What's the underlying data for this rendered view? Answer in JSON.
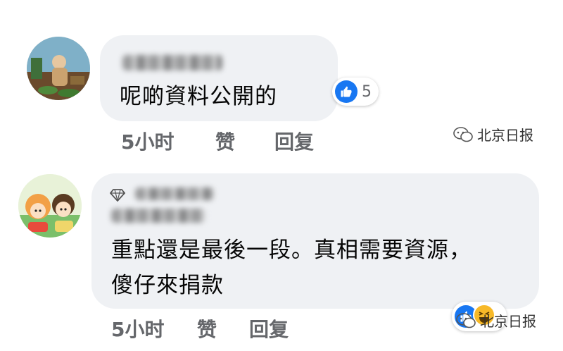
{
  "comments": [
    {
      "author": "",
      "text": "呢啲資料公開的",
      "reactions": {
        "icon": "like-icon",
        "count": "5"
      },
      "time": "5小时",
      "like_label": "赞",
      "reply_label": "回复"
    },
    {
      "author": "",
      "text_line1": "重點還是最後一段。真相需要資源，",
      "text_line2": "傻仔來捐款",
      "reactions": {
        "icons": [
          "like-icon",
          "haha-icon"
        ],
        "count": ""
      },
      "time": "5小时",
      "like_label": "赞",
      "reply_label": "回复"
    }
  ],
  "watermark": {
    "text": "北京日报"
  },
  "colors": {
    "bubble": "#eff1f4",
    "meta_text": "#65676b",
    "like_blue": "#1877f2",
    "haha_yellow": "#f7b928"
  }
}
